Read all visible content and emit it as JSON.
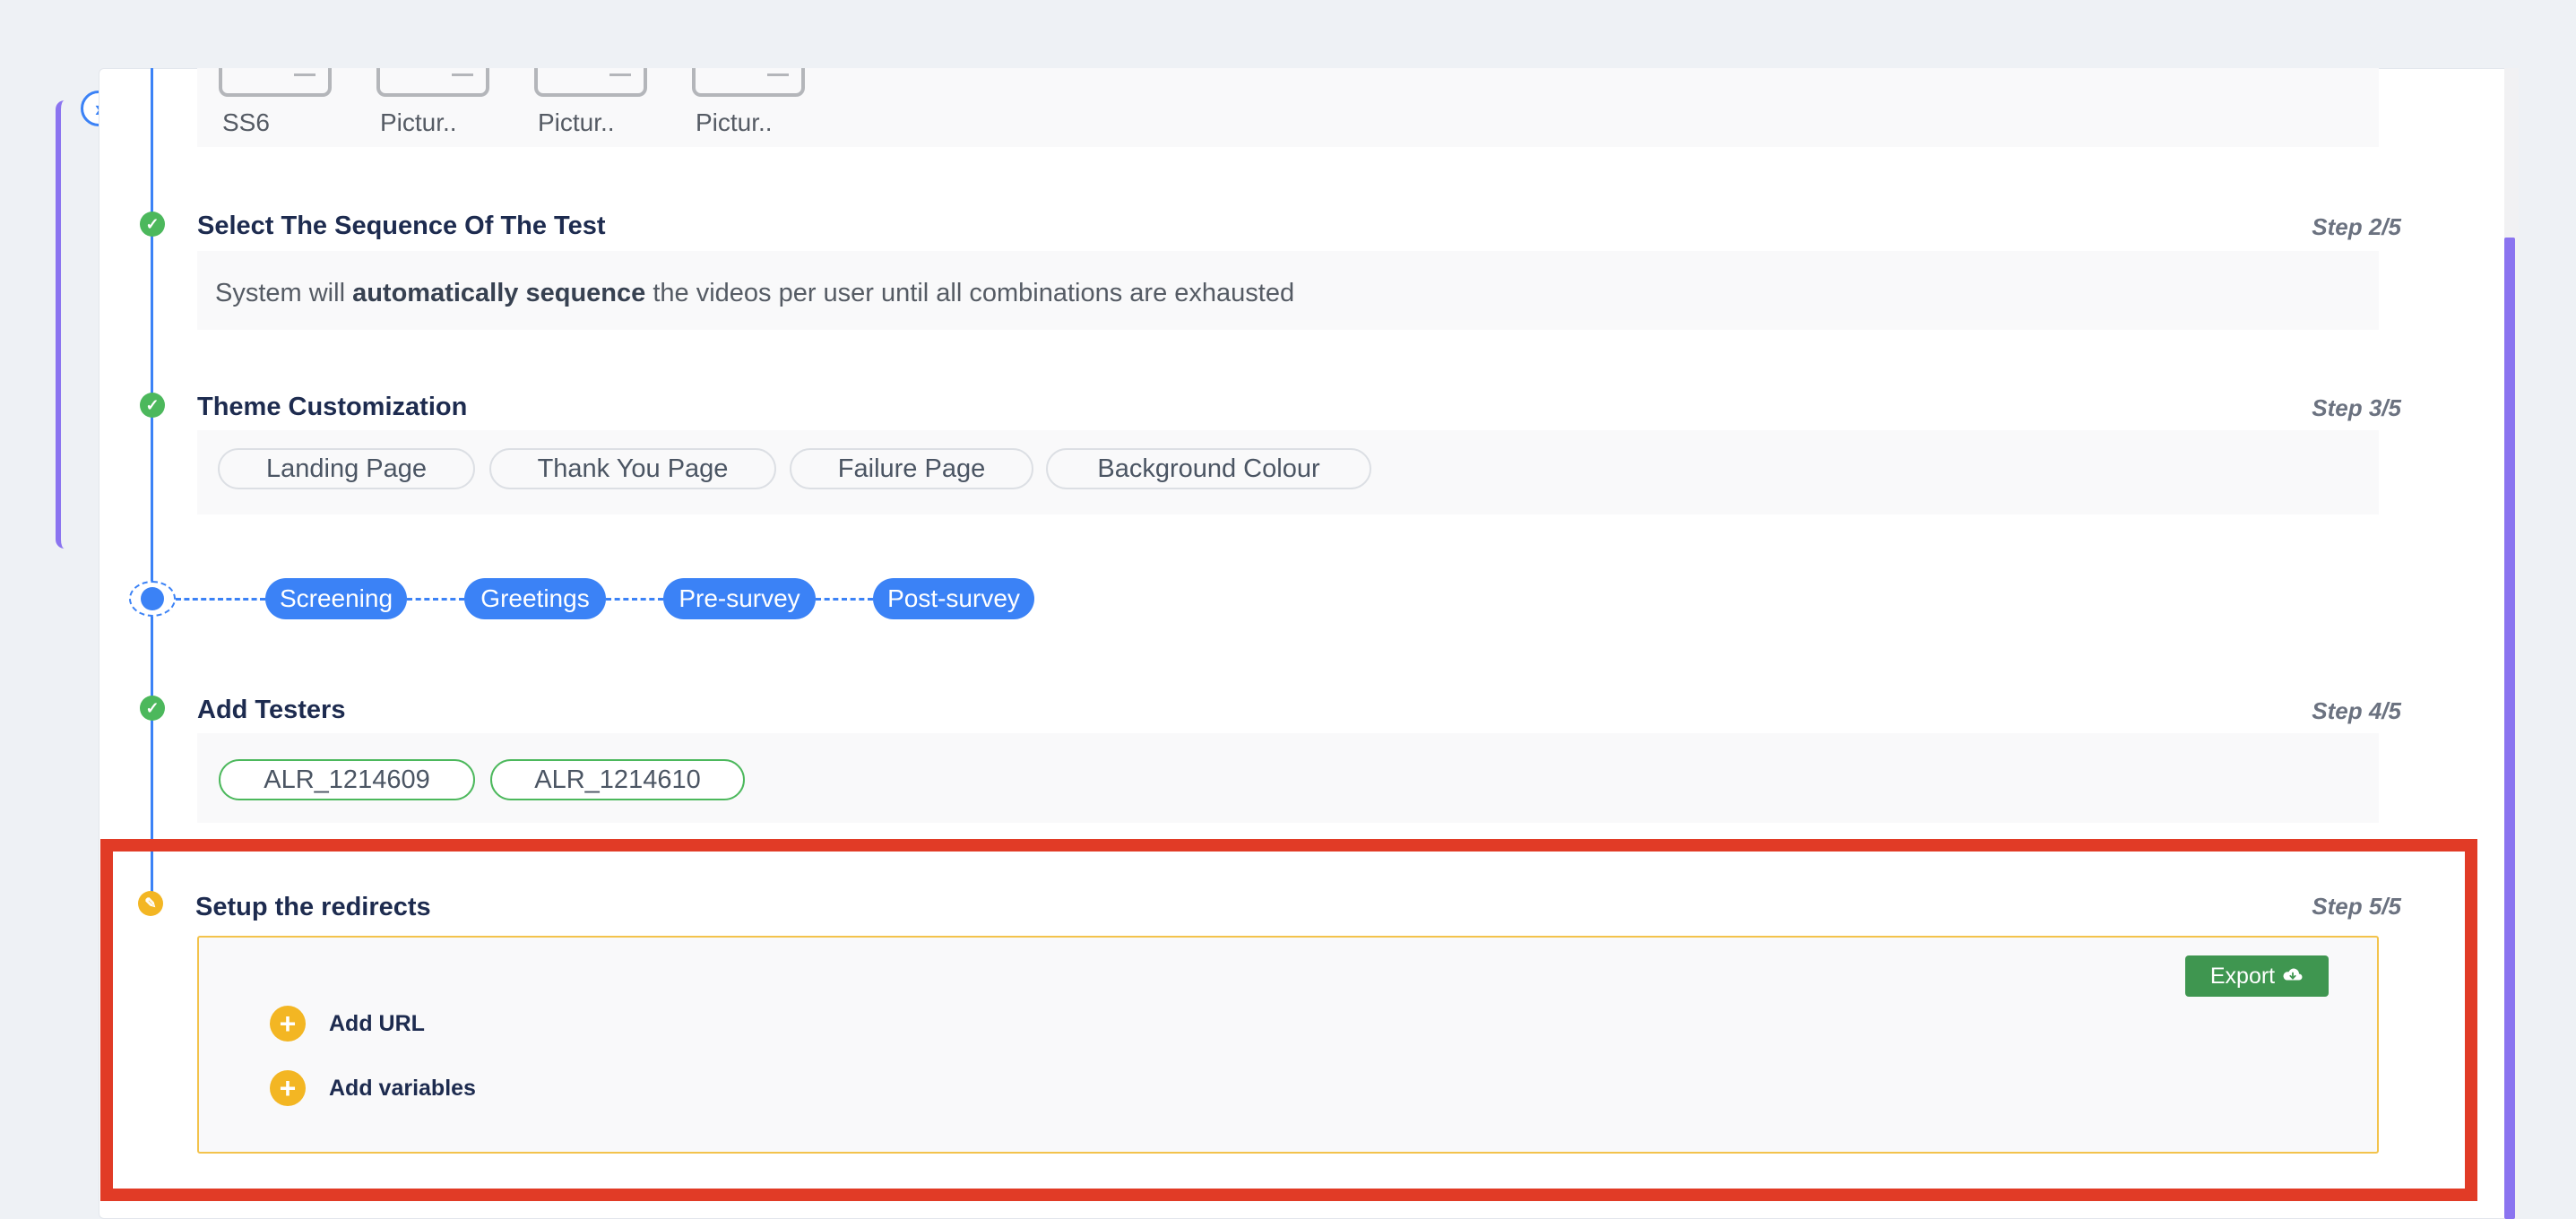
{
  "media": {
    "items": [
      {
        "label": "SS6"
      },
      {
        "label": "Pictur.."
      },
      {
        "label": "Pictur.."
      },
      {
        "label": "Pictur.."
      }
    ]
  },
  "steps": {
    "sequence": {
      "title": "Select The Sequence Of The Test",
      "count": "Step 2/5",
      "text_before": "System will ",
      "text_bold": "automatically sequence",
      "text_after": " the videos per user until all combinations are exhausted"
    },
    "theme": {
      "title": "Theme Customization",
      "count": "Step 3/5",
      "pills": [
        "Landing Page",
        "Thank You Page",
        "Failure Page",
        "Background Colour"
      ]
    },
    "flow": {
      "chips": [
        "Screening",
        "Greetings",
        "Pre-survey",
        "Post-survey"
      ]
    },
    "testers": {
      "title": "Add Testers",
      "count": "Step 4/5",
      "pills": [
        "ALR_1214609",
        "ALR_1214610"
      ]
    },
    "redirects": {
      "title": "Setup the redirects",
      "count": "Step 5/5",
      "export_label": "Export",
      "add_url_label": "Add URL",
      "add_variables_label": "Add variables"
    }
  },
  "icons": {
    "toggle": "chevron-right-icon",
    "done": "check-icon",
    "pending": "pencil-icon",
    "export": "cloud-download-icon",
    "add": "plus-icon"
  },
  "colors": {
    "accent": "#3b82f6",
    "success": "#4cb85c",
    "warning": "#f3b623",
    "export": "#3f9650",
    "highlight": "#e13b26",
    "sidebar_accent": "#8b74f0"
  }
}
